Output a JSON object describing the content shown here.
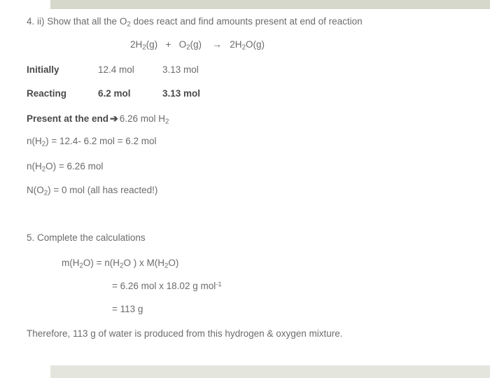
{
  "slide": {
    "theme": {
      "bar_top_color": "#d6d8cc",
      "bar_bottom_color": "#e4e5dd",
      "background": "#ffffff",
      "text_color": "#6b6b6b",
      "bold_text_color": "#4a4a4a"
    }
  },
  "question4": {
    "heading_prefix": "4. ii) Show that all the O",
    "heading_sub": "2",
    "heading_suffix": " does react and find amounts present at end of reaction",
    "equation": {
      "reactant1_coeff": "2H",
      "reactant1_sub": "2",
      "reactant1_state": "(g)",
      "plus": "+",
      "reactant2": "O",
      "reactant2_sub": "2",
      "reactant2_state": "(g)",
      "arrow": "→",
      "product_coeff": "2H",
      "product_sub": "2",
      "product_rest": "O(g)"
    },
    "table": {
      "rows": [
        {
          "label": "Initially",
          "label_bold": true,
          "value_h2": "12.4 mol",
          "value_o2": "3.13 mol",
          "values_bold": false
        },
        {
          "label": "Reacting",
          "label_bold": true,
          "value_h2": "6.2 mol",
          "value_o2": "3.13 mol",
          "values_bold": true
        }
      ]
    },
    "present_at_end": {
      "label": "Present at the end",
      "arrow_icon": "➔",
      "value_prefix": "6.26 mol H",
      "value_sub": "2"
    },
    "calculations": [
      {
        "id": "n-h2",
        "prefix": "n(H",
        "sub": "2",
        "suffix": ") = 12.4- 6.2 mol = 6.2 mol"
      },
      {
        "id": "n-h2o",
        "prefix": "n(H",
        "sub": "2",
        "suffix": "O) = 6.26 mol"
      },
      {
        "id": "n-o2",
        "prefix": "N(O",
        "sub": "2",
        "suffix": ") = 0 mol (all has reacted!)"
      }
    ]
  },
  "question5": {
    "heading": "5. Complete the calculations",
    "formula_line": {
      "p1": "m(H",
      "s1": "2",
      "p2": "O) = n(H",
      "s2": "2",
      "p3": "O ) x M(H",
      "s3": "2",
      "p4": "O)"
    },
    "substitution_line": {
      "prefix": "= 6.26 mol x 18.02 g mol",
      "exponent": "-1"
    },
    "result_line": "= 113 g",
    "conclusion": "Therefore, 113 g of water is produced from this hydrogen & oxygen mixture."
  }
}
